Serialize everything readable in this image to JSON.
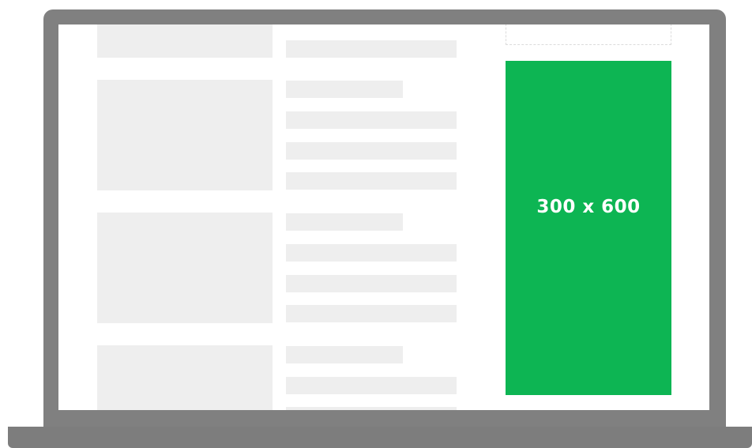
{
  "ad": {
    "size_label": "300 x 600",
    "color": "#0db553"
  },
  "colors": {
    "device_frame": "#808080",
    "screen": "#ffffff",
    "placeholder": "#eeeeee"
  }
}
